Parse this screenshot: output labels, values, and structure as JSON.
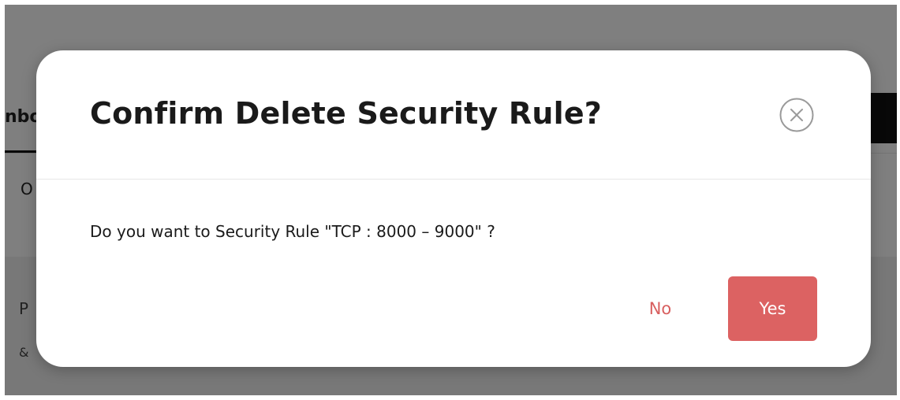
{
  "background": {
    "tab_label": "nbo",
    "row_label": "O",
    "band_label_1": "P",
    "band_label_2": "&"
  },
  "modal": {
    "title": "Confirm Delete Security Rule?",
    "message": "Do you want to Security Rule \"TCP : 8000 – 9000\" ?",
    "close_icon": "close-circle-icon",
    "no_label": "No",
    "yes_label": "Yes"
  },
  "colors": {
    "accent": "#dc6262",
    "no_text": "#d85f5f",
    "overlay": "rgba(0,0,0,0.5)",
    "title_text": "#1a1a1a"
  }
}
